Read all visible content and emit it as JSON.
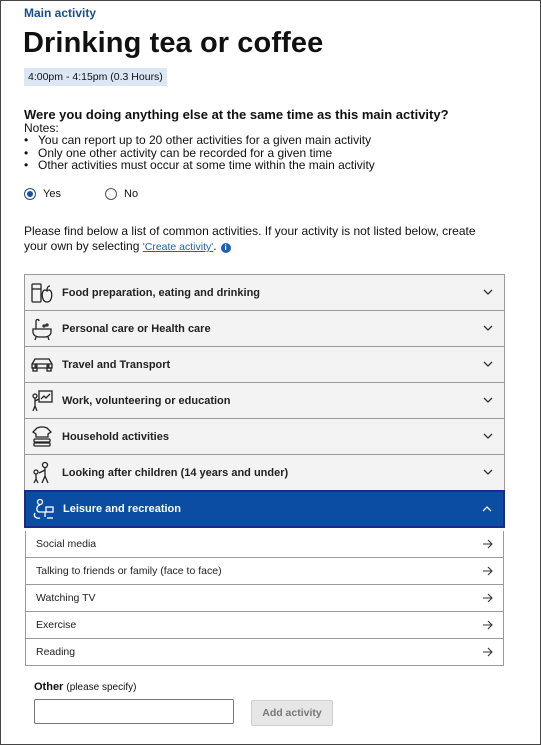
{
  "header": {
    "section_label": "Main activity",
    "title": "Drinking tea or coffee",
    "time_range": "4:00pm - 4:15pm (0.3 Hours)"
  },
  "question": {
    "text": "Were you doing anything else at the same time as this main activity?",
    "notes_label": "Notes:",
    "notes": [
      "You can report up to 20 other activities for a given main activity",
      "Only one other activity can be recorded for a given time",
      "Other activities must occur at some time within the main activity"
    ],
    "options": [
      {
        "label": "Yes",
        "selected": true
      },
      {
        "label": "No",
        "selected": false
      }
    ]
  },
  "intro": {
    "text_before": "Please find below a list of common activities. If your activity is not listed below, create your own by selecting ",
    "link_text": "'Create activity'",
    "text_after": "."
  },
  "categories": [
    {
      "label": "Food preparation, eating and drinking",
      "icon": "food-icon",
      "expanded": false
    },
    {
      "label": "Personal care or Health care",
      "icon": "bath-icon",
      "expanded": false
    },
    {
      "label": "Travel and Transport",
      "icon": "car-icon",
      "expanded": false
    },
    {
      "label": "Work, volunteering or education",
      "icon": "presentation-icon",
      "expanded": false
    },
    {
      "label": "Household activities",
      "icon": "laundry-icon",
      "expanded": false
    },
    {
      "label": "Looking after children (14 years and under)",
      "icon": "child-care-icon",
      "expanded": false
    },
    {
      "label": "Leisure and recreation",
      "icon": "leisure-icon",
      "expanded": true
    }
  ],
  "subitems": [
    {
      "label": "Social media"
    },
    {
      "label": "Talking to friends or family (face to face)"
    },
    {
      "label": "Watching TV"
    },
    {
      "label": "Exercise"
    },
    {
      "label": "Reading"
    }
  ],
  "other": {
    "label": "Other",
    "hint": "(please specify)",
    "value": "",
    "button_label": "Add activity"
  },
  "colors": {
    "accent": "#0b4da2",
    "link": "#1d5fb8",
    "badge_bg": "#dbe7f5"
  }
}
